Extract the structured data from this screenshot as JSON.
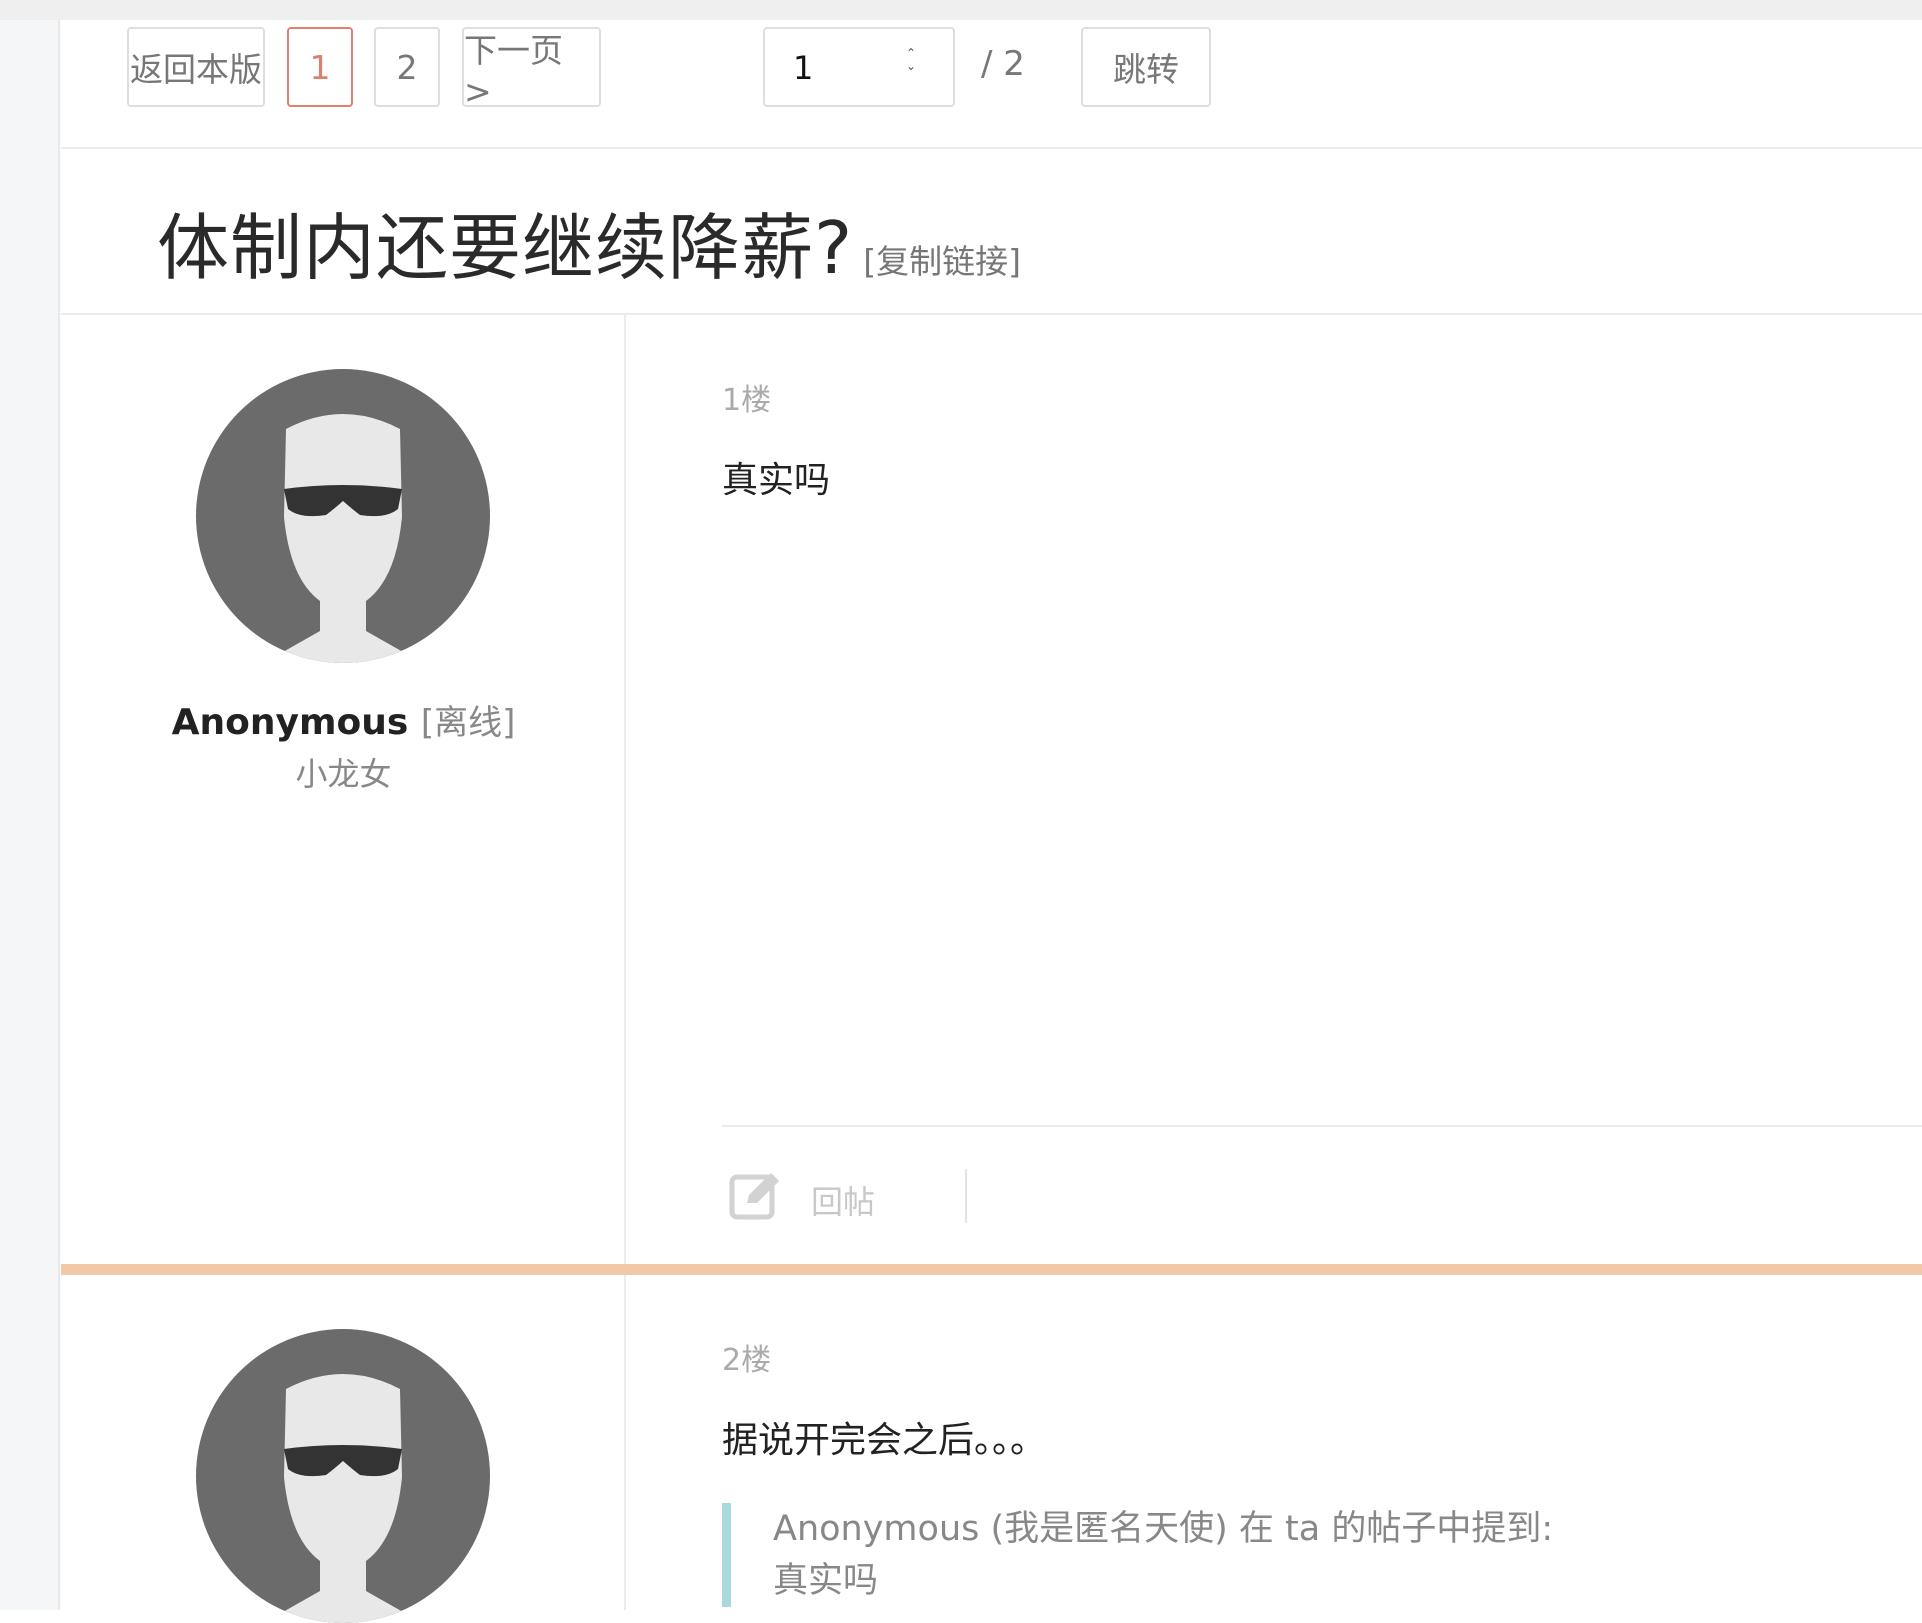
{
  "pager": {
    "back_label": "返回本版",
    "pages": [
      "1",
      "2"
    ],
    "active_page": "1",
    "next_label": "下一页 >",
    "jump_input_value": "1",
    "total_label": "/ 2",
    "jump_label": "跳转"
  },
  "thread": {
    "title": "体制内还要继续降薪?",
    "copy_link_label": "[复制链接]"
  },
  "posts": [
    {
      "floor": "1楼",
      "username": "Anonymous",
      "status": "[离线]",
      "user_title": "小龙女",
      "content": "真实吗",
      "reply_label": "回帖"
    },
    {
      "floor": "2楼",
      "content": "据说开完会之后。。。",
      "quote_header": "Anonymous (我是匿名天使) 在 ta 的帖子中提到:",
      "quote_text": "真实吗"
    }
  ],
  "colors": {
    "active_page": "#d9826e",
    "post_separator": "#f2c9a5",
    "quote_bar": "#a8d9dc",
    "avatar_bg": "#6b6b6b"
  }
}
